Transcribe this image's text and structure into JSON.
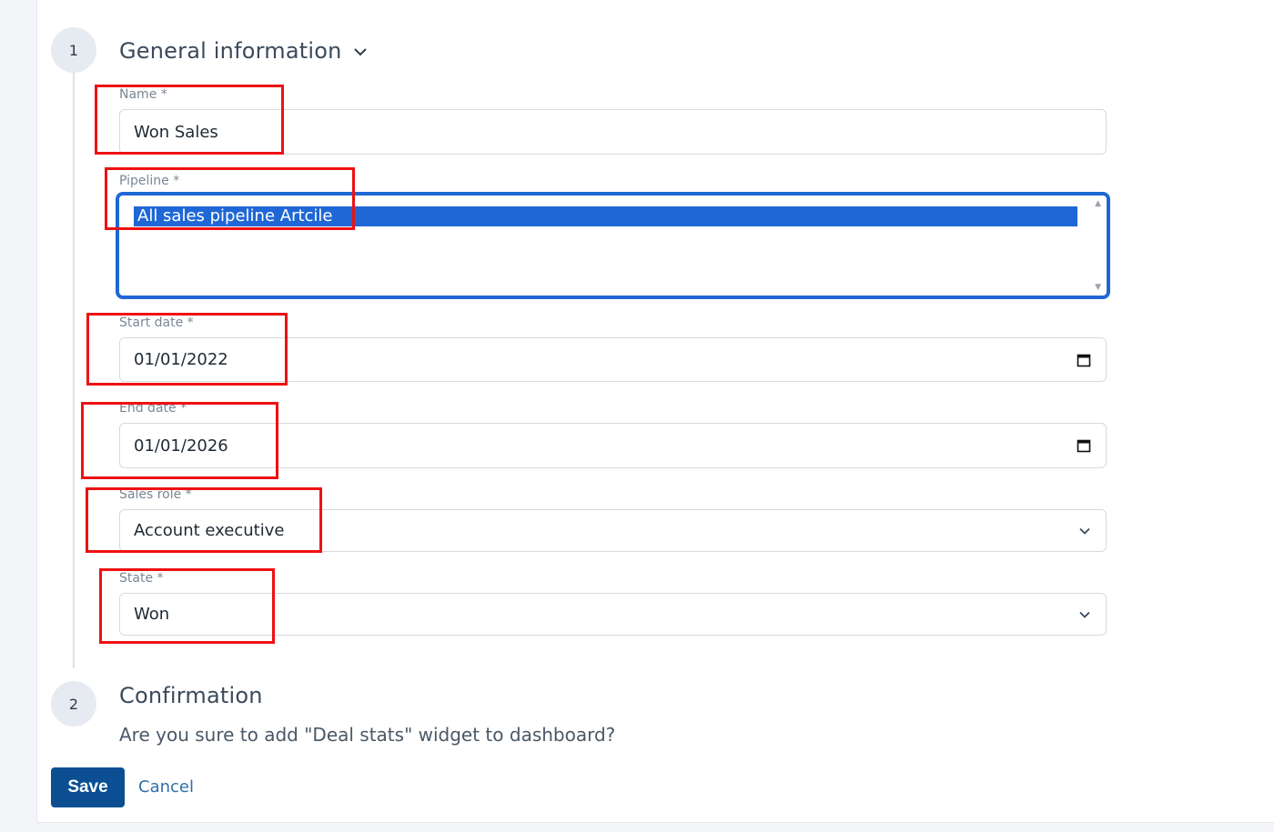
{
  "steps": [
    {
      "number": "1",
      "title": "General information"
    },
    {
      "number": "2",
      "title": "Confirmation"
    }
  ],
  "fields": {
    "name": {
      "label": "Name *",
      "value": "Won Sales"
    },
    "pipeline": {
      "label": "Pipeline *",
      "selected": "All sales pipeline Artcile"
    },
    "start_date": {
      "label": "Start date *",
      "value": "01/01/2022"
    },
    "end_date": {
      "label": "End date *",
      "value": "01/01/2026"
    },
    "sales_role": {
      "label": "Sales role *",
      "value": "Account executive"
    },
    "state": {
      "label": "State *",
      "value": "Won"
    }
  },
  "confirmation": {
    "text": "Are you sure to add \"Deal stats\" widget to dashboard?"
  },
  "actions": {
    "save_label": "Save",
    "cancel_label": "Cancel"
  },
  "icons": {
    "collapse": "chevron-down-icon",
    "calendar": "calendar-icon",
    "dropdown": "chevron-down-icon"
  },
  "colors": {
    "primary_button": "#0b4f92",
    "link": "#2f6fae",
    "focus_ring": "#1f67d6",
    "annotation_box": "#ee1111"
  }
}
